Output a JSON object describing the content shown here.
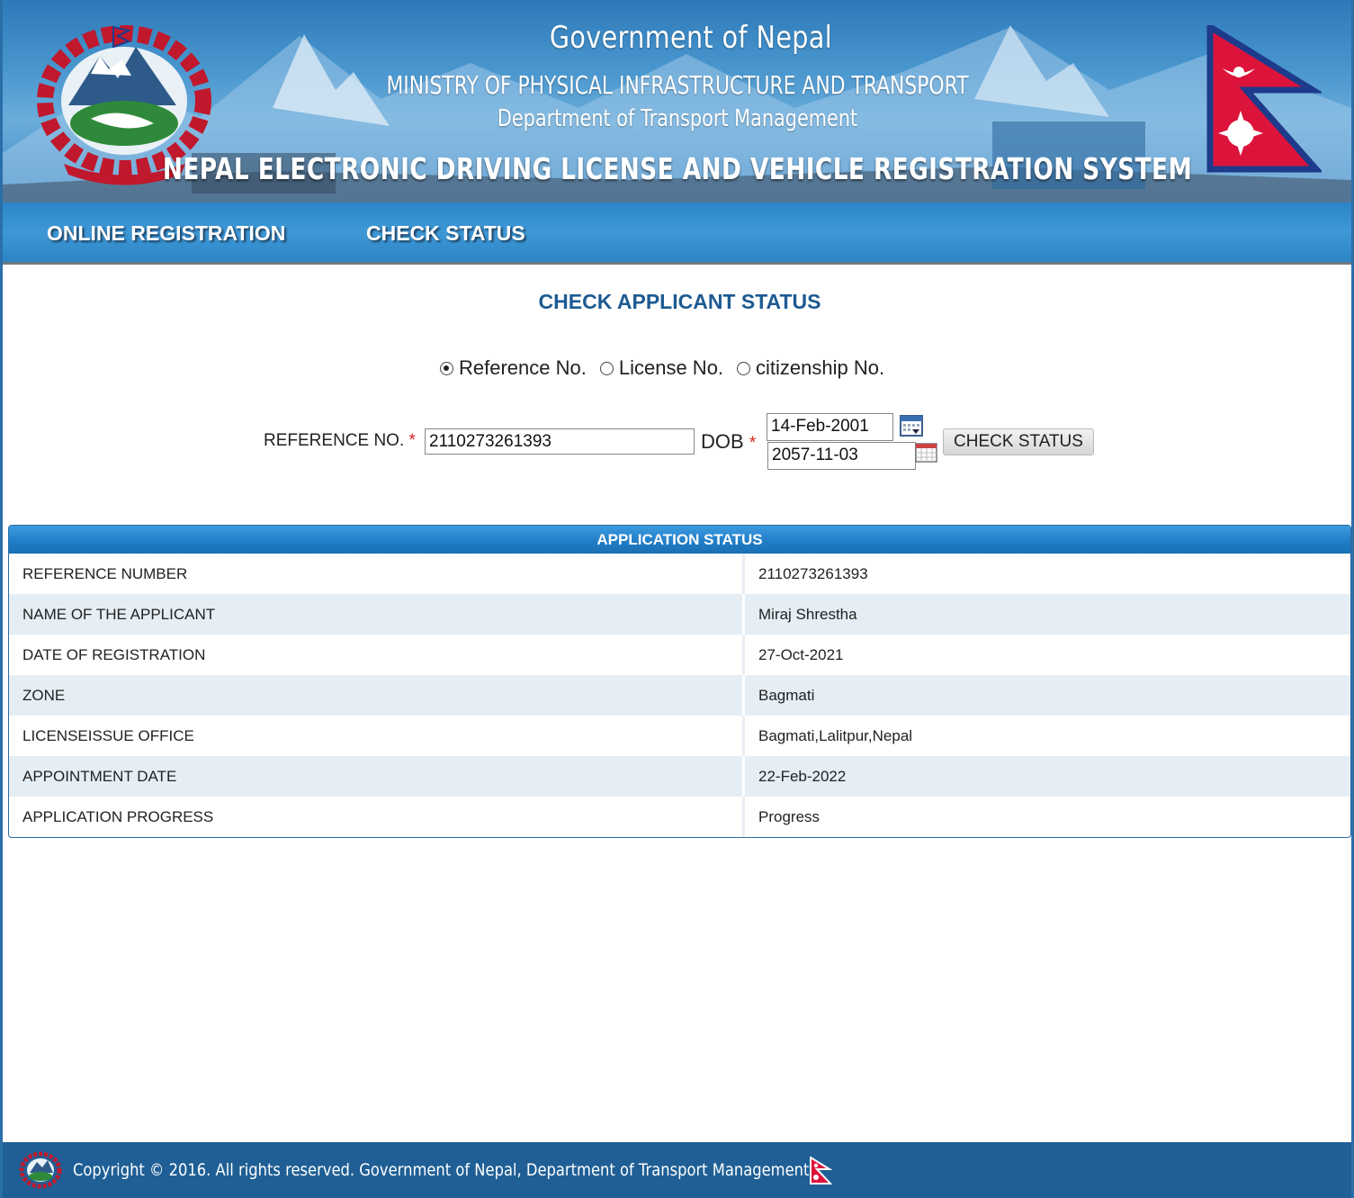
{
  "header": {
    "line1": "Government of Nepal",
    "line2": "MINISTRY OF PHYSICAL INFRASTRUCTURE AND TRANSPORT",
    "line3": "Department of Transport Management",
    "line4": "NEPAL ELECTRONIC DRIVING LICENSE AND VEHICLE REGISTRATION SYSTEM",
    "emblem_icon": "nepal-emblem-icon",
    "flag_icon": "nepal-flag-icon"
  },
  "nav": {
    "items": [
      {
        "label": "ONLINE REGISTRATION"
      },
      {
        "label": "CHECK STATUS"
      }
    ]
  },
  "main": {
    "title": "CHECK APPLICANT STATUS",
    "search_type": {
      "options": [
        "Reference No.",
        "License No.",
        "citizenship No."
      ],
      "selected": "Reference No."
    },
    "reference_label": "REFERENCE NO.",
    "required_mark": "*",
    "reference_value": "2110273261393",
    "dob_label": "DOB",
    "dob_ad": "14-Feb-2001",
    "dob_bs": "2057-11-03",
    "check_button": "CHECK STATUS"
  },
  "status": {
    "heading": "APPLICATION STATUS",
    "rows": [
      {
        "label": "REFERENCE NUMBER",
        "value": "2110273261393"
      },
      {
        "label": "NAME OF THE APPLICANT",
        "value": "Miraj Shrestha"
      },
      {
        "label": "DATE OF REGISTRATION",
        "value": "27-Oct-2021"
      },
      {
        "label": "ZONE",
        "value": "Bagmati"
      },
      {
        "label": "LICENSEISSUE OFFICE",
        "value": "Bagmati,Lalitpur,Nepal"
      },
      {
        "label": "APPOINTMENT DATE",
        "value": "22-Feb-2022"
      },
      {
        "label": "APPLICATION PROGRESS",
        "value": "Progress"
      }
    ]
  },
  "footer": {
    "text": "Copyright © 2016. All rights reserved. Government of Nepal, Department of Transport Management"
  },
  "colors": {
    "brand_blue": "#1d5a92",
    "nav_blue": "#3f98d6",
    "footer_blue": "#1f5f95",
    "required_red": "#dd2222",
    "flag_red": "#dc143c"
  }
}
